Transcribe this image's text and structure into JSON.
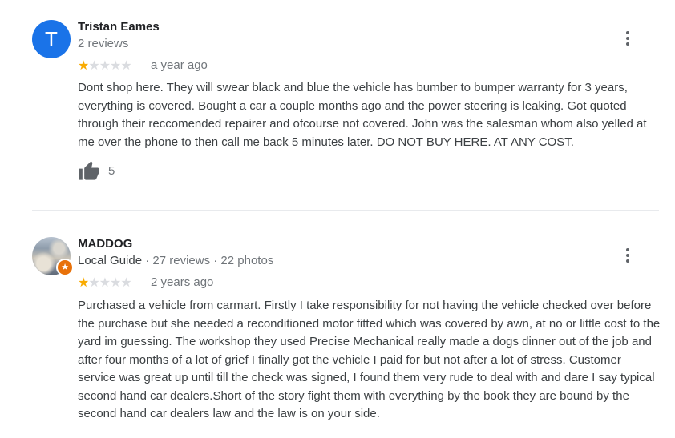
{
  "reviews": [
    {
      "avatar_letter": "T",
      "avatar_color": "#1a73e8",
      "name": "Tristan Eames",
      "meta": "2 reviews",
      "rating": 1,
      "max_rating": 5,
      "time": "a year ago",
      "text": "Dont shop here. They will swear black and blue the vehicle has bumber to bumper warranty for 3 years, everything is covered. Bought a car a couple months ago and the power steering is leaking. Got quoted through their reccomended repairer and ofcourse not covered. John was the salesman whom also yelled at me over the phone to then call me back 5 minutes later. DO NOT BUY HERE. AT ANY COST.",
      "likes": "5"
    },
    {
      "name": "MADDOG",
      "guide_label": "Local Guide",
      "meta_rest": " · 27 reviews · 22 photos",
      "badge_icon": "star-icon",
      "rating": 1,
      "max_rating": 5,
      "time": "2 years ago",
      "text": "Purchased a vehicle from carmart. Firstly I take responsibility for not having the vehicle checked over before the purchase but she  needed a reconditioned motor fitted which was covered by awn, at no or little cost to the yard im guessing. The workshop they used Precise Mechanical really made a dogs dinner out of the job and after four months of a lot of grief I finally got the vehicle I paid for but not after a lot of stress. Customer service was great up until till the check was signed, I found them very rude to deal with and dare I say typical second hand car dealers.Short of the story fight them with everything by the book they are bound by the second hand car dealers law and the law is on your side."
    }
  ],
  "colors": {
    "star_on": "#f9ab00",
    "star_off": "#dadce0",
    "badge": "#e8710a"
  }
}
